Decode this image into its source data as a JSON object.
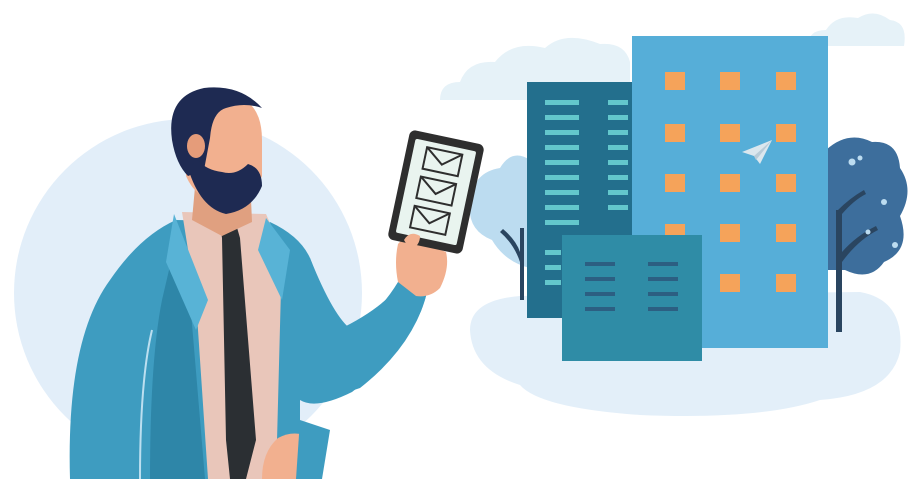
{
  "scene": {
    "description_label": "",
    "colors": {
      "background": "#ffffff",
      "circle_backdrop": "#e2eef9",
      "cloud": "#e6f2f8",
      "ground": "#e3eff9",
      "building_dark": "#236f8d",
      "building_light": "#56aed8",
      "building_front": "#2f8ca6",
      "window_stripe": "#63c7cc",
      "window_orange": "#f5a35a",
      "tree_light": "#bcdcf0",
      "tree_dark": "#3d6e9c",
      "trunk": "#2a4560",
      "suit": "#3e9cc0",
      "suit_shadow": "#2e86a8",
      "shirt": "#e9c6ba",
      "tie": "#2b2f33",
      "skin": "#f2b08f",
      "hair": "#1e2a52",
      "tablet_frame": "#2e2e2e",
      "tablet_screen": "#e9f4ef"
    },
    "icons": [
      "envelope-icon",
      "envelope-icon",
      "envelope-icon",
      "paper-plane-icon"
    ]
  }
}
